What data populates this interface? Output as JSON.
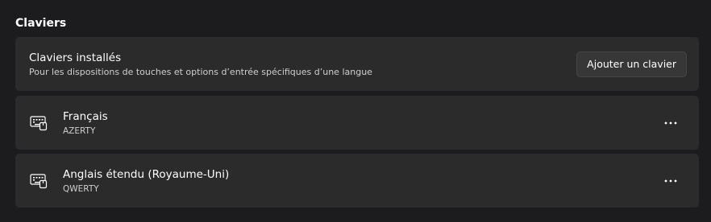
{
  "section": {
    "title": "Claviers"
  },
  "header_card": {
    "title": "Claviers installés",
    "subtitle": "Pour les dispositions de touches et options d’entrée spécifiques d’une langue",
    "add_button_label": "Ajouter un clavier"
  },
  "keyboards": [
    {
      "name": "Français",
      "layout": "AZERTY",
      "icon": "keyboard-icon",
      "more_icon": "more-options-icon"
    },
    {
      "name": "Anglais étendu (Royaume-Uni)",
      "layout": "QWERTY",
      "icon": "keyboard-icon",
      "more_icon": "more-options-icon"
    }
  ],
  "colors": {
    "background": "#1c1c1e",
    "card": "#2b2b2b",
    "button": "#373737",
    "text_primary": "#ffffff",
    "text_secondary": "#cfcfcf"
  }
}
